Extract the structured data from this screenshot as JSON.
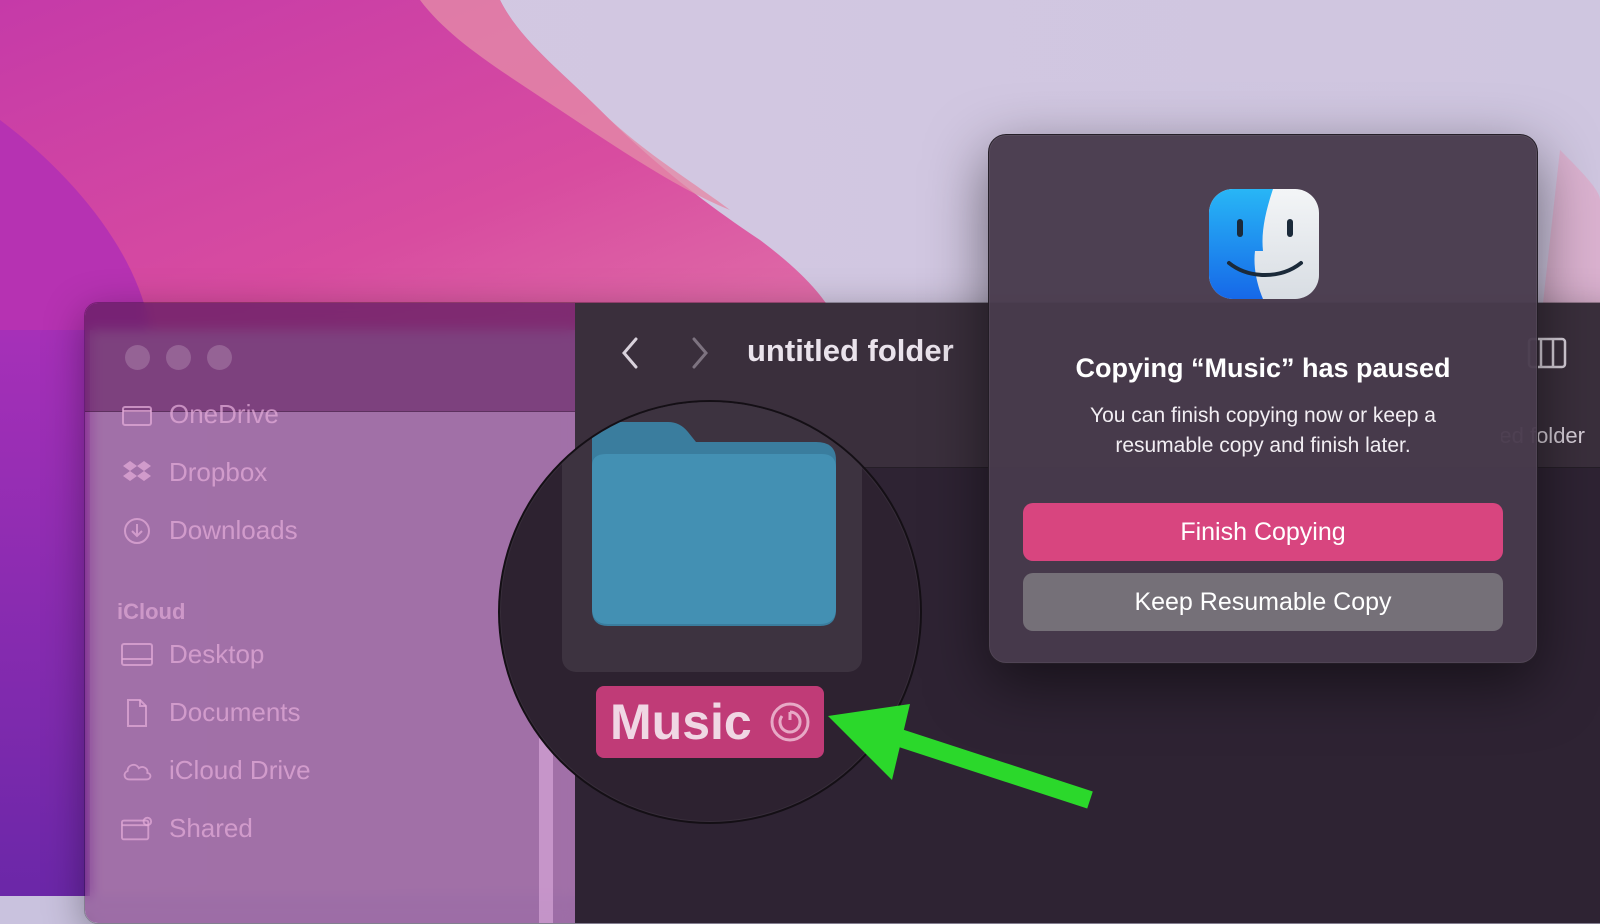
{
  "window": {
    "title": "untitled folder",
    "partial_column_label": "untitled folder"
  },
  "sidebar": {
    "items": [
      {
        "label": "OneDrive",
        "icon": "folder-icon"
      },
      {
        "label": "Dropbox",
        "icon": "dropbox-icon"
      },
      {
        "label": "Downloads",
        "icon": "download-icon"
      }
    ],
    "icloud_header": "iCloud",
    "icloud_items": [
      {
        "label": "Desktop",
        "icon": "desktop-icon"
      },
      {
        "label": "Documents",
        "icon": "document-icon"
      },
      {
        "label": "iCloud Drive",
        "icon": "cloud-icon"
      },
      {
        "label": "Shared",
        "icon": "shared-folder-icon"
      }
    ]
  },
  "content": {
    "folder_name": "Music",
    "folder_status_icon": "resume-icon"
  },
  "dialog": {
    "title": "Copying “Music” has paused",
    "message": "You can finish copying now or keep a resumable copy and finish later.",
    "primary_button": "Finish Copying",
    "secondary_button": "Keep Resumable Copy"
  },
  "colors": {
    "accent": "#d8457f",
    "label_highlight": "#c03b77",
    "folder_blue": "#3d8db0",
    "arrow_green": "#2bd82b"
  }
}
